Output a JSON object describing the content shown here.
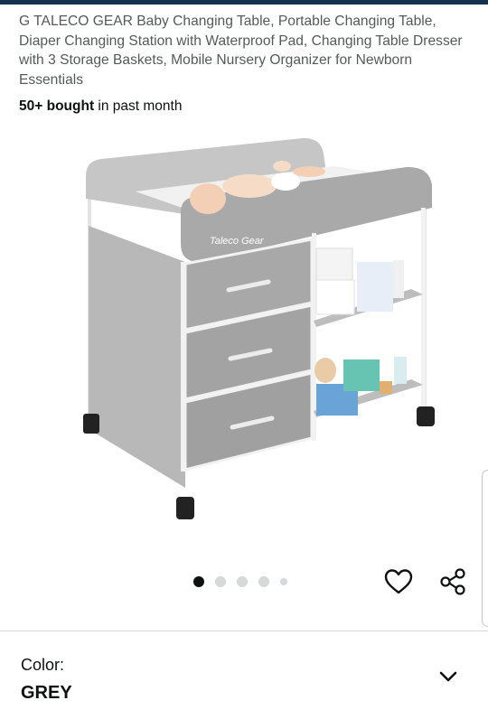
{
  "product": {
    "title": "G TALECO GEAR Baby Changing Table, Portable Changing Table, Diaper Changing Station with Waterproof Pad, Changing Table Dresser with 3 Storage Baskets, Mobile Nursery Organizer for Newborn Essentials",
    "bought_count": "50+ bought",
    "bought_suffix": " in past month",
    "image_brand": "Taleco Gear"
  },
  "carousel": {
    "total": 5,
    "active_index": 0
  },
  "icons": {
    "wishlist": "heart-icon",
    "share": "share-icon",
    "expand": "chevron-down-icon"
  },
  "variation": {
    "label": "Color:",
    "value": "GREY"
  },
  "colors": {
    "topbar": "#14324f",
    "title_text": "#565959",
    "body_text": "#0f1111"
  }
}
